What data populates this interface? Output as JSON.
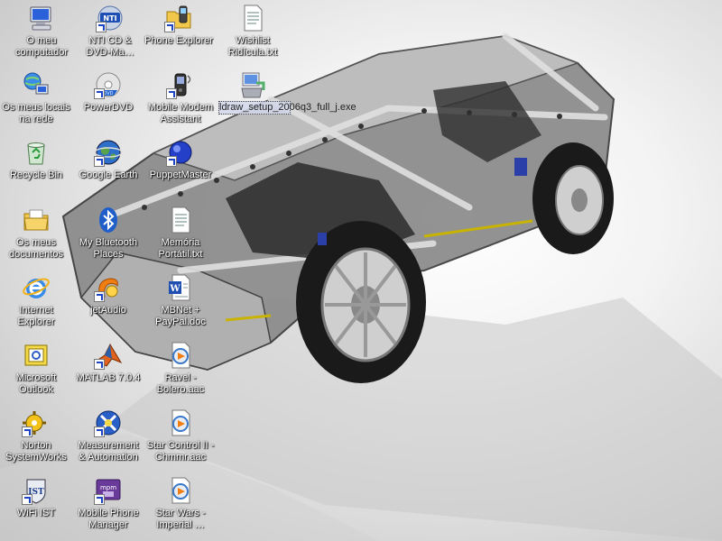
{
  "desktop": {
    "icons": [
      {
        "label": "O meu computador",
        "icon": "my-computer-icon",
        "shortcut": false
      },
      {
        "label": "NTI CD & DVD-Ma…",
        "icon": "nti-cd-dvd-icon",
        "shortcut": true
      },
      {
        "label": "Phone Explorer",
        "icon": "phone-explorer-icon",
        "shortcut": true
      },
      {
        "label": "Wishlist Ridícula.txt",
        "icon": "text-document-icon",
        "shortcut": false
      },
      {
        "label": "Os meus locais na rede",
        "icon": "network-places-icon",
        "shortcut": false
      },
      {
        "label": "PowerDVD",
        "icon": "powerdvd-icon",
        "shortcut": true
      },
      {
        "label": "Mobile Modem Assistant",
        "icon": "mobile-modem-icon",
        "shortcut": true
      },
      {
        "label": "Recycle Bin",
        "icon": "recycle-bin-icon",
        "shortcut": false
      },
      {
        "label": "Google Earth",
        "icon": "google-earth-icon",
        "shortcut": true
      },
      {
        "label": "PuppetMaster",
        "icon": "puppetmaster-icon",
        "shortcut": true
      },
      {
        "label": "Os meus documentos",
        "icon": "my-documents-icon",
        "shortcut": false
      },
      {
        "label": "My Bluetooth Places",
        "icon": "bluetooth-icon",
        "shortcut": false
      },
      {
        "label": "Memória Portátil.txt",
        "icon": "text-document-icon",
        "shortcut": false
      },
      {
        "label": "Internet Explorer",
        "icon": "internet-explorer-icon",
        "shortcut": false
      },
      {
        "label": "jetAudio",
        "icon": "jetaudio-icon",
        "shortcut": true
      },
      {
        "label": "MBNet + PayPal.doc",
        "icon": "word-document-icon",
        "shortcut": false
      },
      {
        "label": "Microsoft Outlook",
        "icon": "outlook-icon",
        "shortcut": false
      },
      {
        "label": "MATLAB 7.0.4",
        "icon": "matlab-icon",
        "shortcut": true
      },
      {
        "label": "Ravel - Bolero.aac",
        "icon": "media-file-icon",
        "shortcut": false
      },
      {
        "label": "Norton SystemWorks",
        "icon": "norton-icon",
        "shortcut": true
      },
      {
        "label": "Measurement & Automation",
        "icon": "measurement-automation-icon",
        "shortcut": true
      },
      {
        "label": "Star Control II - Chmmr.aac",
        "icon": "media-file-icon",
        "shortcut": false
      },
      {
        "label": "WiFi IST",
        "icon": "wifi-ist-icon",
        "shortcut": true
      },
      {
        "label": "Mobile Phone Manager",
        "icon": "mobile-phone-manager-icon",
        "shortcut": true
      },
      {
        "label": "Star Wars - Imperial …",
        "icon": "media-file-icon",
        "shortcut": false
      }
    ],
    "dragged_item": {
      "label": "ldraw_setup_2006q3_full_j.exe",
      "icon": "installer-icon"
    },
    "wallpaper": "lego-technic-car",
    "colors": {
      "label_text": "#ffffff",
      "selection": "#316ac5",
      "background": "#e6e6e6"
    }
  }
}
